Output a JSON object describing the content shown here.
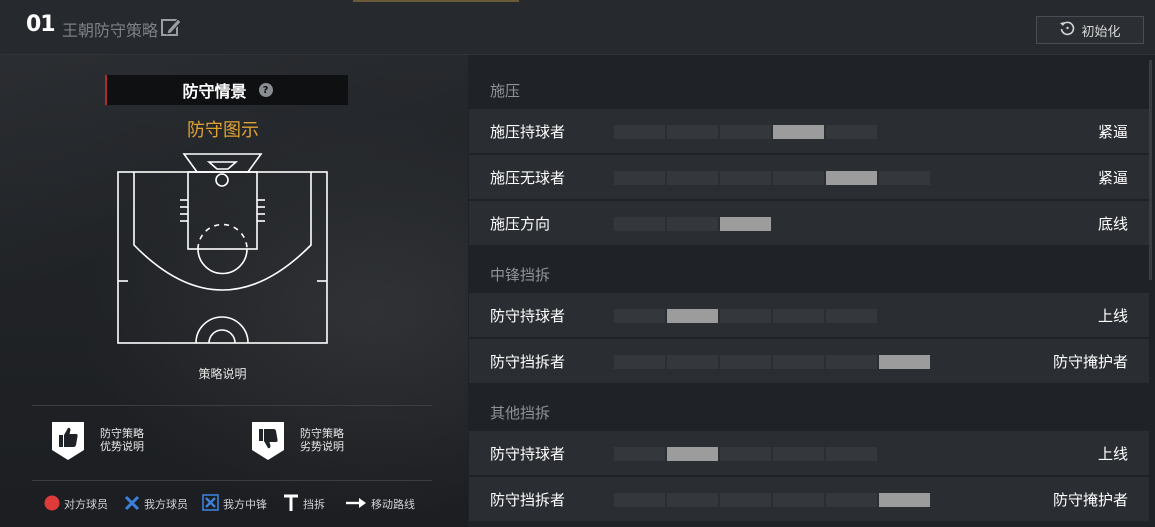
{
  "header": {
    "plan_number": "01",
    "plan_name": "王朝防守策略",
    "reset_label": "初始化"
  },
  "left": {
    "scene_title": "防守情景",
    "scene_help_glyph": "?",
    "diagram_title": "防守图示",
    "strategy_desc": "策略说明",
    "pros": [
      "防守策略",
      "优势说明"
    ],
    "cons": [
      "防守策略",
      "劣势说明"
    ],
    "legend": {
      "opponent": "对方球员",
      "my_player": "我方球员",
      "my_center": "我方中锋",
      "screen": "挡拆",
      "route": "移动路线"
    }
  },
  "sections": [
    {
      "title": "施压",
      "rows": [
        {
          "label": "施压持球者",
          "value": "紧逼",
          "segments": 5,
          "level": 4
        },
        {
          "label": "施压无球者",
          "value": "紧逼",
          "segments": 6,
          "level": 5
        },
        {
          "label": "施压方向",
          "value": "底线",
          "segments": 3,
          "level": 3
        }
      ]
    },
    {
      "title": "中锋挡拆",
      "rows": [
        {
          "label": "防守持球者",
          "value": "上线",
          "segments": 5,
          "level": 2
        },
        {
          "label": "防守挡拆者",
          "value": "防守掩护者",
          "segments": 6,
          "level": 6
        }
      ]
    },
    {
      "title": "其他挡拆",
      "rows": [
        {
          "label": "防守持球者",
          "value": "上线",
          "segments": 5,
          "level": 2
        },
        {
          "label": "防守挡拆者",
          "value": "防守掩护者",
          "segments": 6,
          "level": 6
        }
      ]
    }
  ],
  "colors": {
    "accent_orange": "#e0a235",
    "accent_red": "#b02a2a",
    "slider_active": "#9c9c9c",
    "slider_inactive": "#34373c",
    "opponent_dot": "#e03b3b",
    "player_blue": "#3d7fd9"
  }
}
